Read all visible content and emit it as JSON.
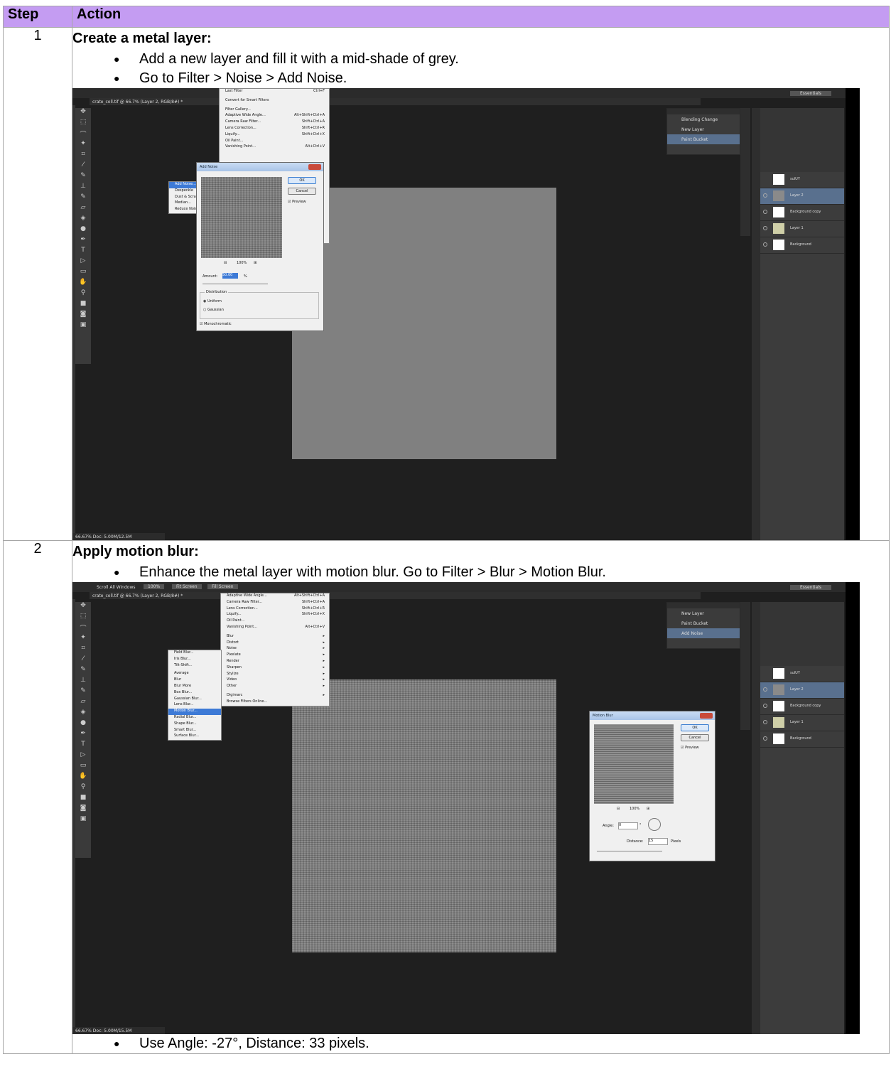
{
  "table": {
    "header_step": "Step",
    "header_action": "Action"
  },
  "steps": [
    {
      "number": "1",
      "title": "Create a metal layer:",
      "bullets": [
        "Add a new layer and fill it with a mid-shade of grey.",
        "Go to Filter > Noise > Add Noise."
      ],
      "screenshot": {
        "menu_items": [
          "Last Filter",
          "Convert for Smart Filters",
          "Filter Gallery...",
          "Adaptive Wide Angle...",
          "Camera Raw Filter...",
          "Lens Correction...",
          "Liquify...",
          "Oil Paint...",
          "Vanishing Point..."
        ],
        "menu_shortcuts": [
          "Ctrl+F",
          "",
          "",
          "Alt+Shift+Ctrl+A",
          "Shift+Ctrl+A",
          "Shift+Ctrl+R",
          "Shift+Ctrl+X",
          "",
          "Alt+Ctrl+V"
        ],
        "submenu_items": [
          "Add Noise...",
          "Despeckle",
          "Dust & Scratches...",
          "Median...",
          "Reduce Noise..."
        ],
        "dialog_title": "Add Noise",
        "ok": "OK",
        "cancel": "Cancel",
        "preview": "Preview",
        "zoom": "100%",
        "amount_label": "Amount:",
        "amount_value": "50.00",
        "amount_unit": "%",
        "distribution_label": "Distribution",
        "uniform": "Uniform",
        "gaussian": "Gaussian",
        "monochromatic": "Monochromatic",
        "history_items": [
          "Blending Change",
          "New Layer",
          "Paint Bucket"
        ],
        "layers": [
          "sulUY",
          "Layer 2",
          "Background copy",
          "Layer 1",
          "Background"
        ],
        "workspace": "Essentials",
        "doc_tab": "crate_coll.tif @ 66.7% (Layer 2, RGB/8#) *",
        "status": "66.67%   Doc: 5.00M/12.5M"
      }
    },
    {
      "number": "2",
      "title": "Apply motion blur:",
      "bullets": [
        "Enhance the metal layer with motion blur. Go to Filter > Blur > Motion Blur."
      ],
      "after": "Use Angle: -27°, Distance: 33 pixels.",
      "screenshot": {
        "menu_items": [
          "Adaptive Wide Angle...",
          "Camera Raw Filter...",
          "Lens Correction...",
          "Liquify...",
          "Oil Paint...",
          "Vanishing Point...",
          "Blur",
          "Distort",
          "Noise",
          "Pixelate",
          "Render",
          "Sharpen",
          "Stylize",
          "Video",
          "Other",
          "Digimarc",
          "Browse Filters Online..."
        ],
        "menu_shortcuts": [
          "Alt+Shift+Ctrl+A",
          "Shift+Ctrl+A",
          "Shift+Ctrl+R",
          "Shift+Ctrl+X",
          "",
          "Alt+Ctrl+V",
          "",
          "",
          "",
          "",
          "",
          "",
          "",
          "",
          "",
          "",
          ""
        ],
        "submenu_items": [
          "Field Blur...",
          "Iris Blur...",
          "Tilt-Shift...",
          "Average",
          "Blur",
          "Blur More",
          "Box Blur...",
          "Gaussian Blur...",
          "Lens Blur...",
          "Motion Blur...",
          "Radial Blur...",
          "Shape Blur...",
          "Smart Blur...",
          "Surface Blur..."
        ],
        "dialog_title": "Motion Blur",
        "ok": "OK",
        "cancel": "Cancel",
        "preview": "Preview",
        "zoom": "100%",
        "angle_label": "Angle:",
        "angle_value": "0",
        "distance_label": "Distance:",
        "distance_value": "15",
        "distance_unit": "Pixels",
        "history_items": [
          "New Layer",
          "Paint Bucket",
          "Add Noise"
        ],
        "layers": [
          "sulUY",
          "Layer 2",
          "Background copy",
          "Layer 1",
          "Background"
        ],
        "workspace": "Essentials",
        "toolbar_buttons": [
          "Scroll All Windows",
          "100%",
          "Fit Screen",
          "Fill Screen"
        ],
        "doc_tab": "crate_coll.tif @ 66.7% (Layer 2, RGB/8#) *",
        "status": "66.67%   Doc: 5.00M/15.5M"
      }
    }
  ]
}
